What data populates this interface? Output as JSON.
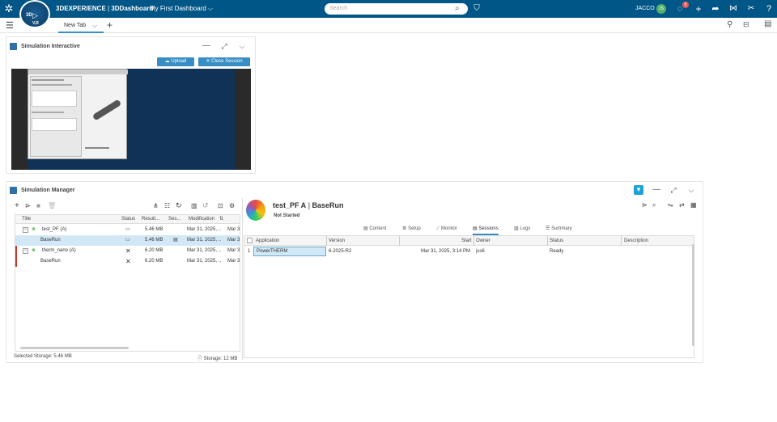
{
  "topbar": {
    "brand_bold": "3DEXPERIENCE",
    "brand_sep": " | ",
    "brand_app": "3DDashboard",
    "dashboard_name": "My First Dashboard",
    "compass_label": "3D",
    "compass_version": "V,R",
    "search_placeholder": "Search",
    "user_name": "JACCO",
    "user_initials": "JS",
    "notification_count": "8"
  },
  "tabbar": {
    "tab_label": "New Tab",
    "add_tab": "+"
  },
  "sim_interactive": {
    "title": "Simulation Interactive",
    "upload_label": "Upload",
    "close_session_label": "Close Session"
  },
  "sim_manager": {
    "title": "Simulation Manager",
    "tree_headers": [
      "Title",
      "Status",
      "Result...",
      "Ses...",
      "Modification"
    ],
    "tree_rows": [
      {
        "title": "test_PF (A)",
        "status": "▭",
        "result": "5.46 MB",
        "session": "",
        "modification": "Mar 31, 2025, ...",
        "extra": "Mar 3"
      },
      {
        "title": "BaseRun",
        "status": "▭",
        "result": "5.46 MB",
        "session": "▤",
        "modification": "Mar 31, 2025, ...",
        "extra": "Mar 3"
      },
      {
        "title": "therm_nano (A)",
        "status": "✕",
        "result": "6.20 MB",
        "session": "",
        "modification": "Mar 31, 2025, ...",
        "extra": "Mar 3"
      },
      {
        "title": "BaseRun",
        "status": "✕",
        "result": "6.20 MB",
        "session": "",
        "modification": "Mar 31, 2025, ...",
        "extra": "Mar 3"
      }
    ],
    "selected_storage": "Selected Storage: 5.46 MB",
    "storage": "Storage: 12 MB",
    "detail_title": "test_PF A",
    "detail_sep": " | ",
    "detail_subtitle": "BaseRun",
    "detail_status": "Not Started",
    "detail_tabs": [
      "Content",
      "Setup",
      "Monitor",
      "Sessions",
      "Logs",
      "Summary"
    ],
    "session_headers": [
      "Application",
      "Version",
      "Start",
      "Owner",
      "Status",
      "Description"
    ],
    "session_rows": [
      {
        "index": "1",
        "application": "PowerTHERM",
        "version": "6-2025-R2",
        "start": "Mar 31, 2025, 3:14 PM",
        "owner": "jss6",
        "status": "Ready",
        "description": ""
      }
    ]
  },
  "colors": {
    "topbar": "#005686",
    "accent": "#368ec4",
    "selection": "#d3e8f6",
    "viewport": "#0f3256"
  }
}
